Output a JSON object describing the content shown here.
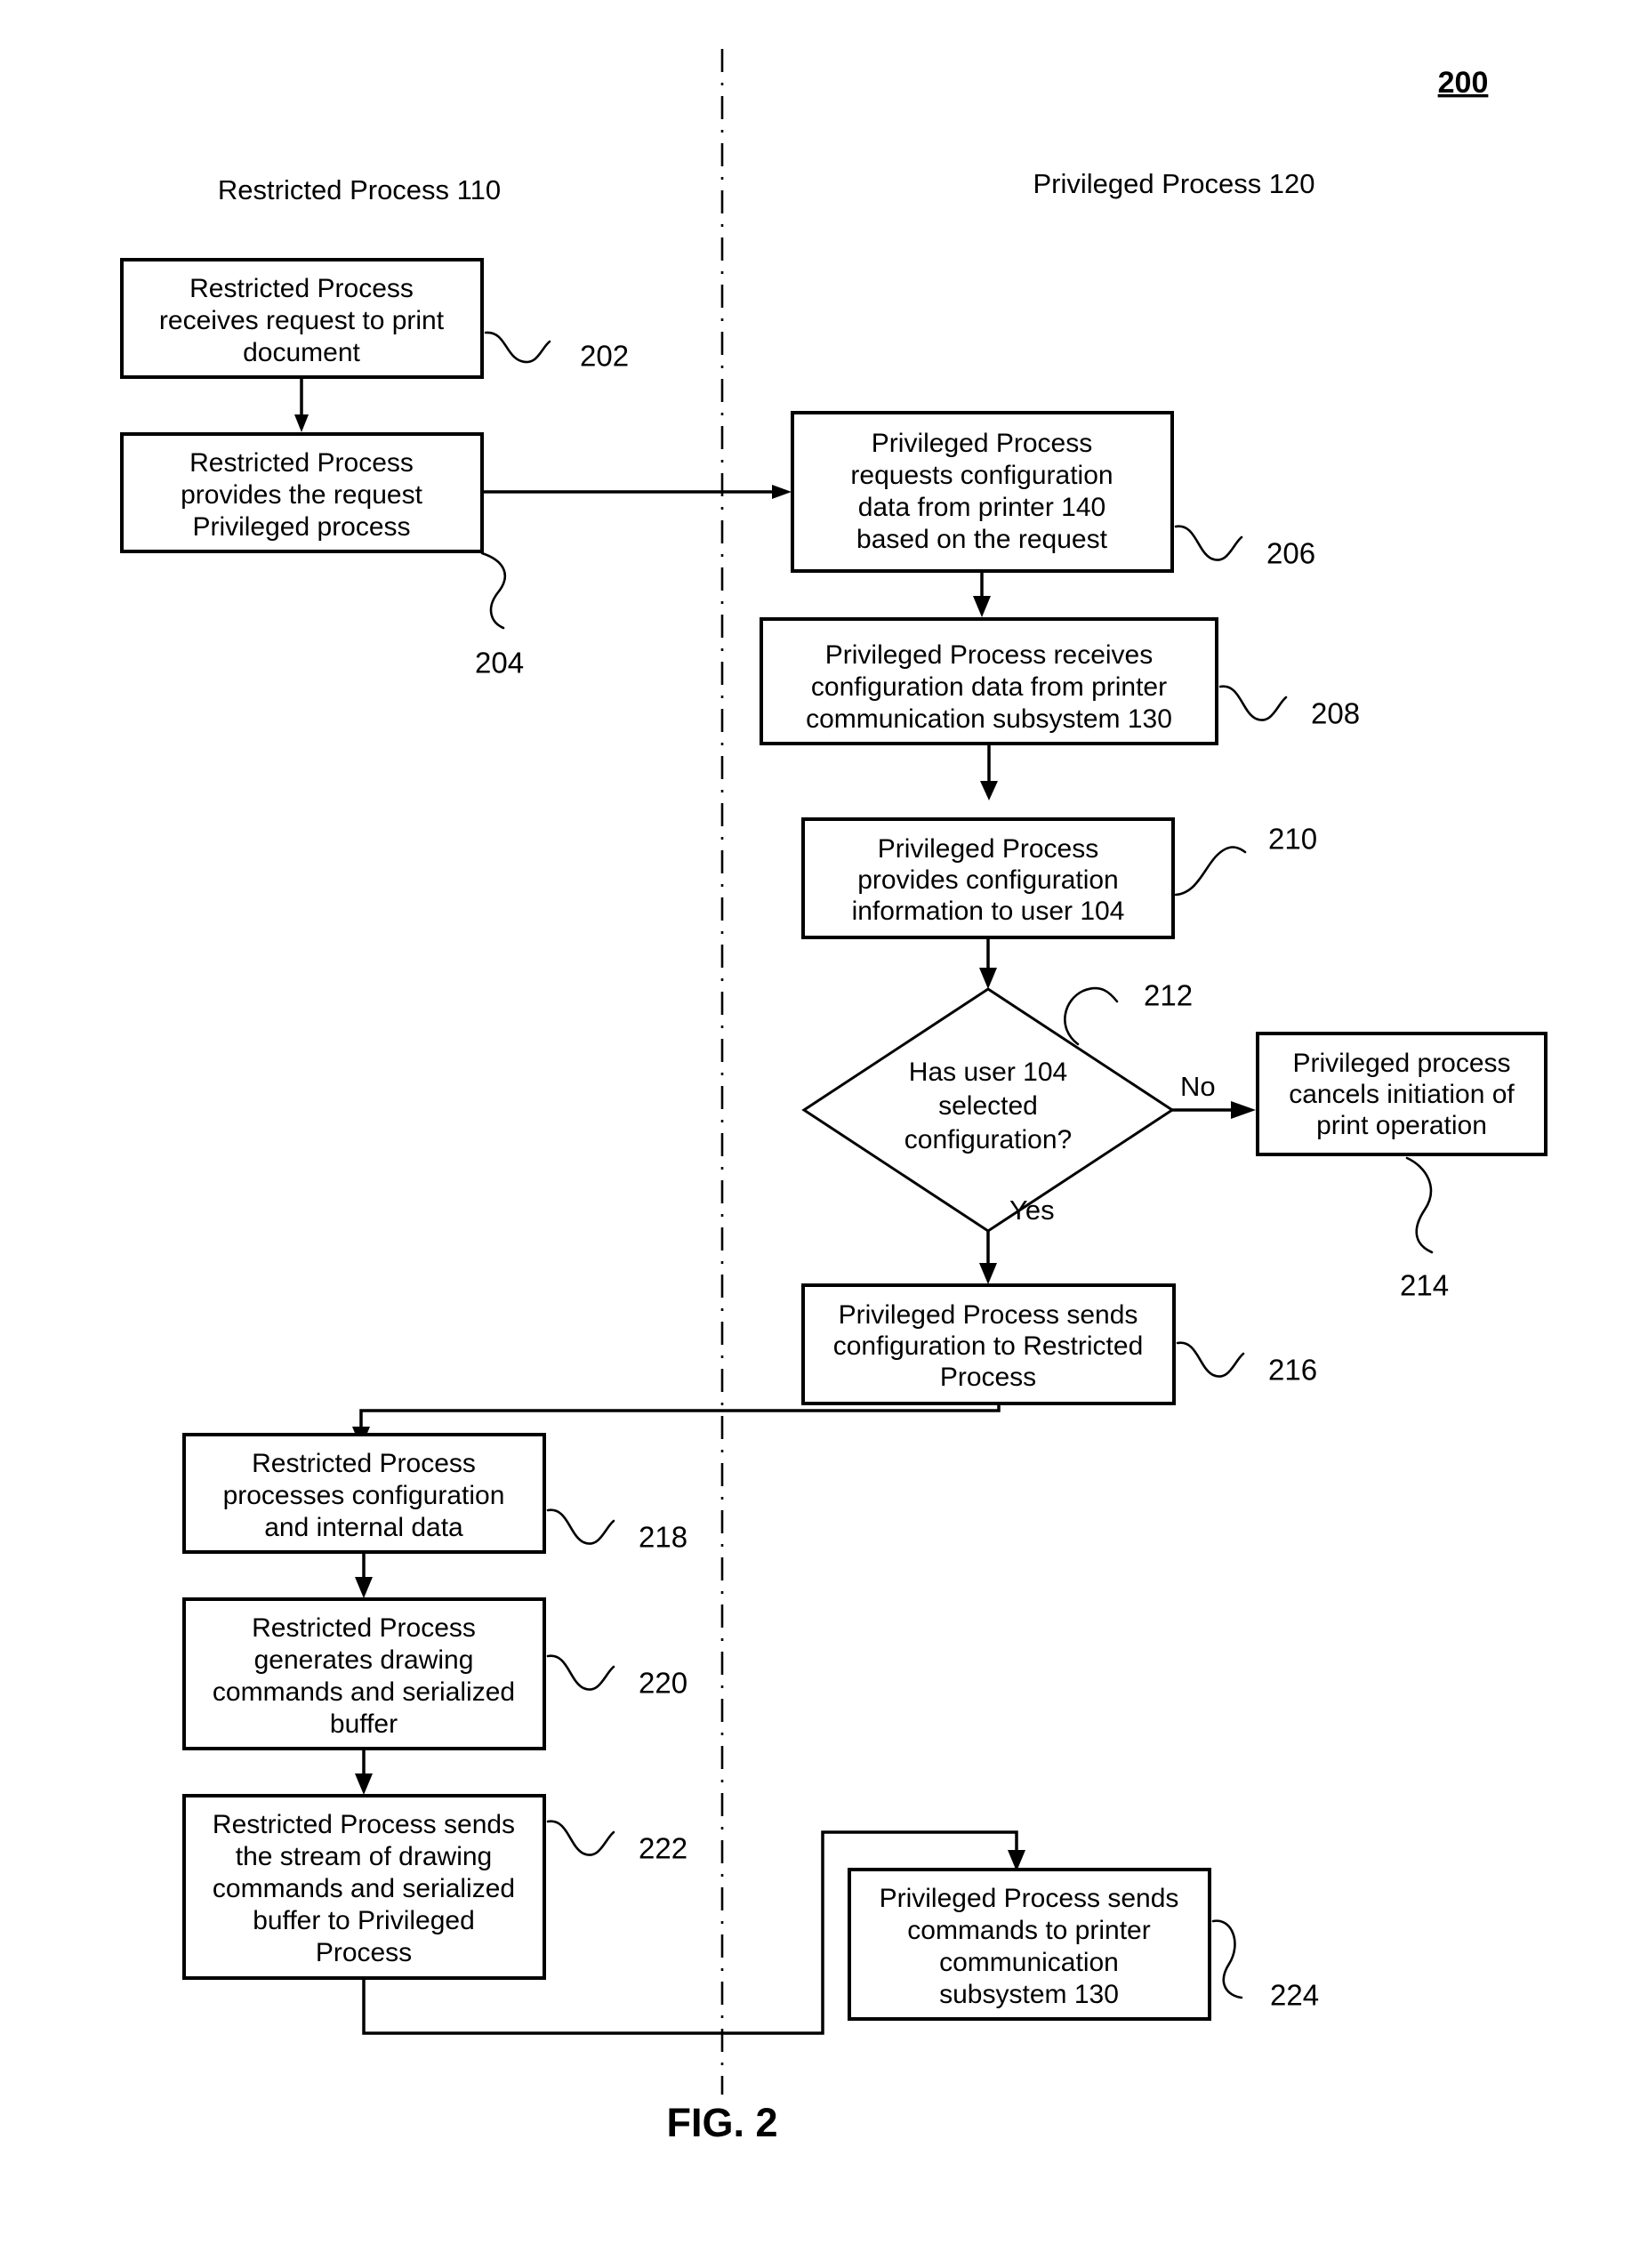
{
  "figure": {
    "number_label": "200",
    "caption": "FIG. 2"
  },
  "columns": [
    {
      "id": "restricted",
      "header": "Restricted Process 110"
    },
    {
      "id": "privileged",
      "header": "Privileged Process 120"
    }
  ],
  "branch_labels": {
    "no": "No",
    "yes": "Yes"
  },
  "nodes": [
    {
      "id": "n202",
      "ref": "202",
      "shape": "box",
      "column": "restricted",
      "lines": [
        "Restricted Process",
        "receives request to print",
        "document"
      ]
    },
    {
      "id": "n204",
      "ref": "204",
      "shape": "box",
      "column": "restricted",
      "lines": [
        "Restricted Process",
        "provides the request",
        "Privileged process"
      ]
    },
    {
      "id": "n206",
      "ref": "206",
      "shape": "box",
      "column": "privileged",
      "lines": [
        "Privileged Process",
        "requests configuration",
        "data from printer 140",
        "based on the request"
      ]
    },
    {
      "id": "n208",
      "ref": "208",
      "shape": "box",
      "column": "privileged",
      "lines": [
        "Privileged Process receives",
        "configuration data from printer",
        "communication subsystem 130"
      ]
    },
    {
      "id": "n210",
      "ref": "210",
      "shape": "box",
      "column": "privileged",
      "lines": [
        "Privileged Process",
        "provides configuration",
        "information to user 104"
      ]
    },
    {
      "id": "n212",
      "ref": "212",
      "shape": "diamond",
      "column": "privileged",
      "lines": [
        "Has user 104",
        "selected",
        "configuration?"
      ]
    },
    {
      "id": "n214",
      "ref": "214",
      "shape": "box",
      "column": "privileged",
      "lines": [
        "Privileged process",
        "cancels initiation of",
        "print operation"
      ]
    },
    {
      "id": "n216",
      "ref": "216",
      "shape": "box",
      "column": "privileged",
      "lines": [
        "Privileged Process sends",
        "configuration to Restricted",
        "Process"
      ]
    },
    {
      "id": "n218",
      "ref": "218",
      "shape": "box",
      "column": "restricted",
      "lines": [
        "Restricted Process",
        "processes configuration",
        "and internal data"
      ]
    },
    {
      "id": "n220",
      "ref": "220",
      "shape": "box",
      "column": "restricted",
      "lines": [
        "Restricted Process",
        "generates drawing",
        "commands and serialized",
        "buffer"
      ]
    },
    {
      "id": "n222",
      "ref": "222",
      "shape": "box",
      "column": "restricted",
      "lines": [
        "Restricted Process sends",
        "the stream of drawing",
        "commands and serialized",
        "buffer to Privileged",
        "Process"
      ]
    },
    {
      "id": "n224",
      "ref": "224",
      "shape": "box",
      "column": "privileged",
      "lines": [
        "Privileged Process sends",
        "commands to printer",
        "communication",
        "subsystem 130"
      ]
    }
  ],
  "colors": {
    "ink": "#000000",
    "paper": "#ffffff"
  }
}
